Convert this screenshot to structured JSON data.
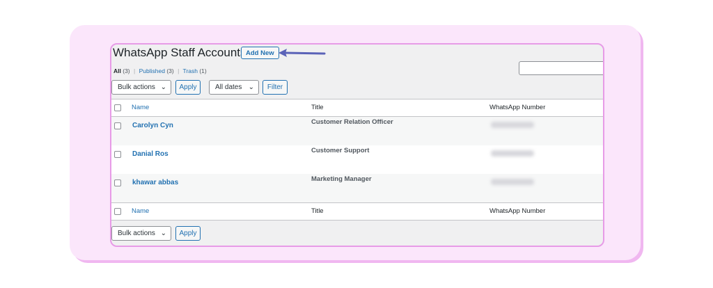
{
  "page": {
    "title": "WhatsApp Staff Accounts",
    "add_new_label": "Add New"
  },
  "views": {
    "all_label": "All",
    "all_count": "(3)",
    "published_label": "Published",
    "published_count": "(3)",
    "trash_label": "Trash",
    "trash_count": "(1)",
    "separator": "|"
  },
  "search": {
    "value": ""
  },
  "top_actions": {
    "bulk_label": "Bulk actions",
    "apply_label": "Apply",
    "dates_label": "All dates",
    "filter_label": "Filter"
  },
  "bottom_actions": {
    "bulk_label": "Bulk actions",
    "apply_label": "Apply"
  },
  "columns": {
    "name": "Name",
    "title": "Title",
    "whatsapp": "WhatsApp Number"
  },
  "rows": [
    {
      "name": "Carolyn Cyn",
      "title": "Customer Relation Officer"
    },
    {
      "name": "Danial Ros",
      "title": "Customer Support"
    },
    {
      "name": "khawar abbas",
      "title": "Marketing Manager"
    }
  ],
  "icons": {
    "dropdown": "chevron-down-icon",
    "pointer": "arrow-left-icon"
  },
  "colors": {
    "accent": "#2271b1",
    "frame_bg": "#fbe6fb",
    "frame_border": "#e79be7",
    "arrow": "#5b63b8"
  }
}
